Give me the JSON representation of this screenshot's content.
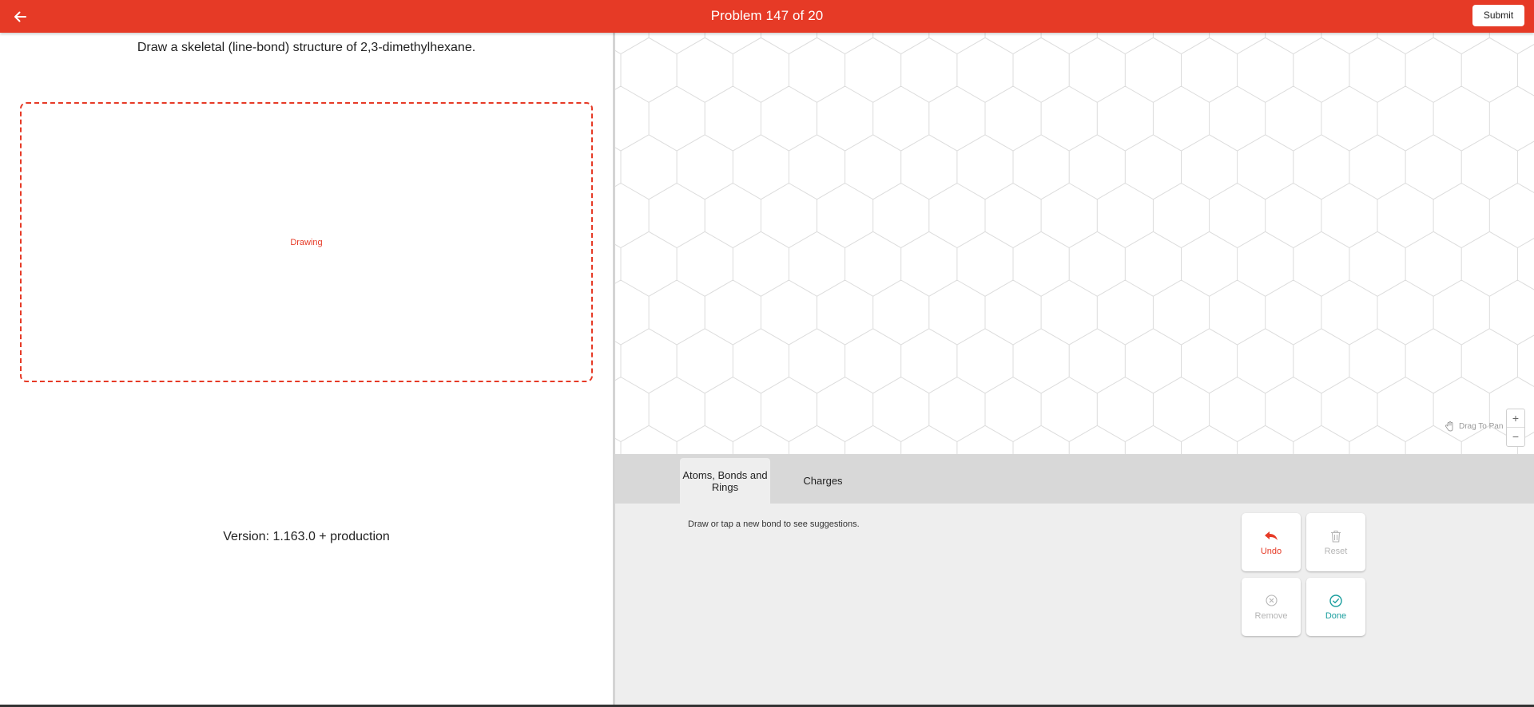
{
  "header": {
    "title": "Problem 147 of 20",
    "submit_label": "Submit",
    "back_icon": "arrow-left-icon",
    "color": "#e63a26"
  },
  "left": {
    "question": "Draw a skeletal (line-bond) structure of 2,3-dimethylhexane.",
    "drawing_label": "Drawing",
    "version": "Version: 1.163.0 +  production"
  },
  "canvas": {
    "pan_hint": "Drag To Pan",
    "pan_icon": "hand-icon",
    "zoom_in": "+",
    "zoom_out": "−"
  },
  "tools": {
    "tabs": [
      {
        "label": "Atoms, Bonds and Rings",
        "active": true
      },
      {
        "label": "Charges",
        "active": false
      }
    ],
    "hint": "Draw or tap a new bond to see suggestions.",
    "actions": {
      "undo": "Undo",
      "reset": "Reset",
      "remove": "Remove",
      "done": "Done"
    },
    "colors": {
      "undo": "#e63a26",
      "disabled": "#b5b5b5",
      "done": "#1a9e9e"
    }
  }
}
